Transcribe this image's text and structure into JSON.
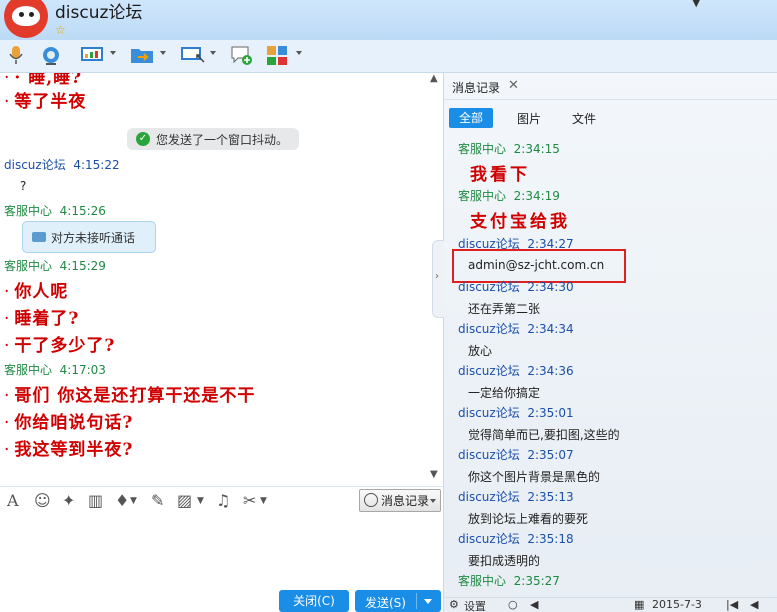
{
  "window": {
    "title": "discuz论坛",
    "dropdown": "▼"
  },
  "chat": {
    "cut_line": "· 睡,睡?",
    "messages": [
      {
        "type": "big",
        "text": "等了半夜"
      },
      {
        "type": "notice",
        "text": "您发送了一个窗口抖动。"
      },
      {
        "type": "header",
        "sender": "discuz论坛",
        "time": "4:15:22"
      },
      {
        "type": "plain",
        "text": "?"
      },
      {
        "type": "header",
        "sender": "客服中心",
        "time": "4:15:26"
      },
      {
        "type": "call",
        "text": "对方未接听通话"
      },
      {
        "type": "header",
        "sender": "客服中心",
        "time": "4:15:29"
      },
      {
        "type": "big",
        "text": "你人呢"
      },
      {
        "type": "big",
        "text": "睡着了?"
      },
      {
        "type": "big",
        "text": "干了多少了?"
      },
      {
        "type": "header",
        "sender": "客服中心",
        "time": "4:17:03"
      },
      {
        "type": "big",
        "text": "哥们 你这是还打算干还是不干"
      },
      {
        "type": "big",
        "text": "你给咱说句话?"
      },
      {
        "type": "big",
        "text": "我这等到半夜?"
      }
    ]
  },
  "input_toolbar": {
    "history_label": "消息记录"
  },
  "buttons": {
    "close": "关闭(C)",
    "send": "发送(S)"
  },
  "history_panel": {
    "tab_label": "消息记录",
    "filters": [
      "全部",
      "图片",
      "文件"
    ],
    "entries": [
      {
        "sender": "客服中心",
        "time": "2:34:15",
        "text": "我看下",
        "style": "big"
      },
      {
        "sender": "客服中心",
        "time": "2:34:19",
        "text": "支付宝给我",
        "style": "big"
      },
      {
        "sender": "discuz论坛",
        "time": "2:34:27",
        "text": "admin@sz-jcht.com.cn",
        "style": "plain"
      },
      {
        "sender": "discuz论坛",
        "time": "2:34:30",
        "text": "还在弄第二张",
        "style": "plain"
      },
      {
        "sender": "discuz论坛",
        "time": "2:34:34",
        "text": "放心",
        "style": "plain"
      },
      {
        "sender": "discuz论坛",
        "time": "2:34:36",
        "text": "一定给你搞定",
        "style": "plain"
      },
      {
        "sender": "discuz论坛",
        "time": "2:35:01",
        "text": "觉得简单而已,要扣图,这些的",
        "style": "plain"
      },
      {
        "sender": "discuz论坛",
        "time": "2:35:07",
        "text": "你这个图片背景是黑色的",
        "style": "plain"
      },
      {
        "sender": "discuz论坛",
        "time": "2:35:13",
        "text": "放到论坛上难看的要死",
        "style": "plain"
      },
      {
        "sender": "discuz论坛",
        "time": "2:35:18",
        "text": "要扣成透明的",
        "style": "plain"
      },
      {
        "sender": "客服中心",
        "time": "2:35:27",
        "text": "",
        "style": "plain"
      }
    ],
    "bottom": {
      "settings": "设置",
      "date": "2015-7-3"
    }
  },
  "colors": {
    "accent": "#1a8ee6",
    "contact_self": "#1b4fa8",
    "contact_other": "#1f8a43",
    "emphasis": "#d10000",
    "highlight_box": "#e02020"
  }
}
